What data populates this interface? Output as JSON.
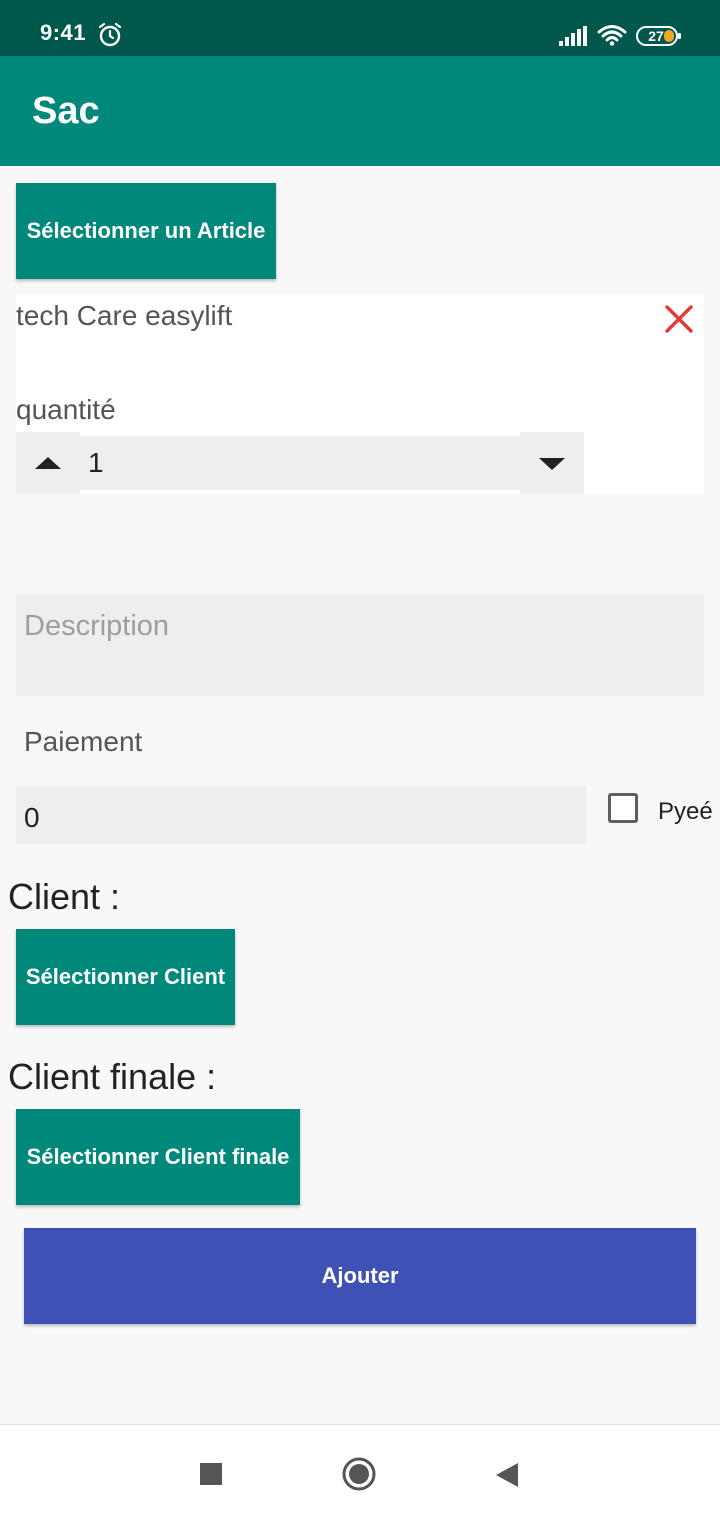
{
  "status_bar": {
    "time": "9:41",
    "icons": [
      "alarm-icon",
      "signal-icon",
      "wifi-icon",
      "battery-icon"
    ],
    "battery_level": "27"
  },
  "app_bar": {
    "title": "Sac"
  },
  "article": {
    "select_button_label": "Sélectionner un Article",
    "name": "tech Care easylift",
    "quantity_label": "quantité",
    "quantity_value": "1"
  },
  "description": {
    "placeholder": "Description",
    "value": ""
  },
  "payment": {
    "label": "Paiement",
    "value": "0",
    "checkbox_label": "Pyeé",
    "checked": false
  },
  "client": {
    "title": "Client :",
    "select_button_label": "Sélectionner Client"
  },
  "final_client": {
    "title": "Client finale :",
    "select_button_label": "Sélectionner Client finale"
  },
  "submit": {
    "label": "Ajouter"
  },
  "nav_bar": {
    "icons": [
      "recents-square-icon",
      "home-circle-icon",
      "back-triangle-icon"
    ]
  },
  "colors": {
    "status_bar": "#00574B",
    "primary": "#00897B",
    "accent_button": "#3F51B5",
    "remove_icon": "#E53935"
  }
}
